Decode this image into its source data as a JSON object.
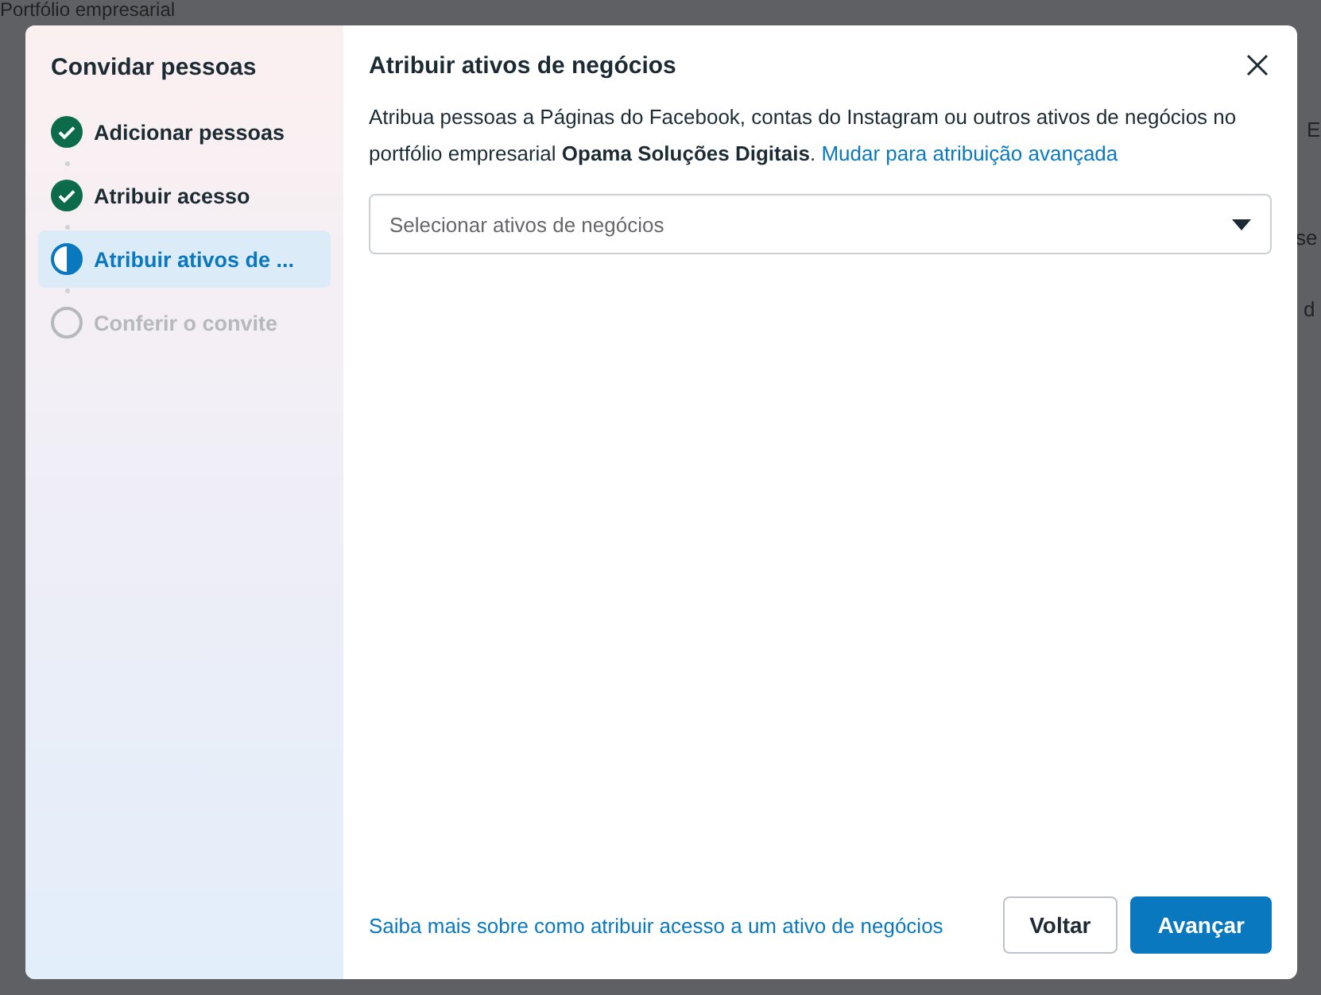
{
  "background": {
    "title": "Portfólio empresarial",
    "fragments": [
      "E",
      "se",
      "d"
    ]
  },
  "dialog": {
    "sidebar": {
      "title": "Convidar pessoas",
      "steps": [
        {
          "label": "Adicionar pessoas",
          "kind": "done",
          "selected": false
        },
        {
          "label": "Atribuir acesso",
          "kind": "done",
          "selected": false
        },
        {
          "label": "Atribuir ativos de ...",
          "kind": "current",
          "selected": true
        },
        {
          "label": "Conferir o convite",
          "kind": "pending",
          "selected": false
        }
      ]
    },
    "title": "Atribuir ativos de negócios",
    "description": "Atribua pessoas a Páginas do Facebook, contas do Instagram ou outros ativos de negócios no portfólio empresarial **Opama Soluções Digitais**.",
    "advanced_link": "Mudar para atribuição avançada",
    "select": {
      "placeholder": "Selecionar ativos de negócios"
    },
    "help_link": "Saiba mais sobre como atribuir acesso a um ativo de negócios",
    "buttons": [
      {
        "label": "Voltar",
        "kind": "secondary"
      },
      {
        "label": "Avançar",
        "kind": "primary"
      }
    ]
  }
}
